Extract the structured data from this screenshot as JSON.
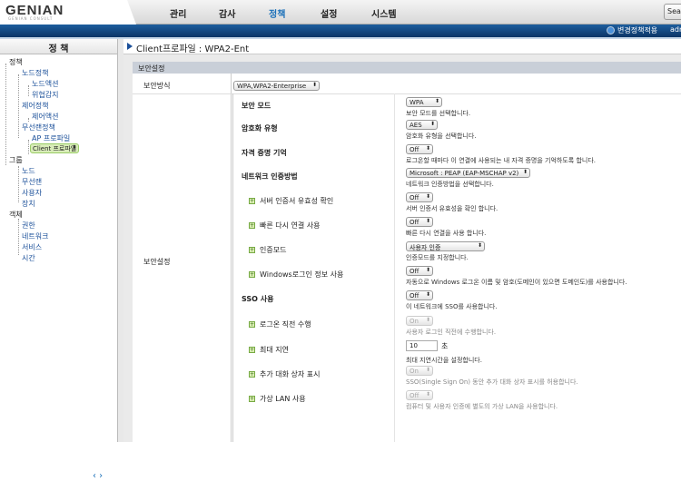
{
  "topbar": {
    "logo": "GENIAN",
    "logo_sub": "GENIAN CONSULT",
    "menus": [
      "관리",
      "감사",
      "정책",
      "설정",
      "시스템"
    ],
    "active": "정책",
    "search": "Sear"
  },
  "bluebar": {
    "apply": "변경정책적용",
    "user": "adm"
  },
  "sidebar": {
    "title": "정 책",
    "tree": [
      "정책",
      "노드정책",
      "노드액션",
      "위협감지",
      "제어정책",
      "제어액션",
      "무선랜정책",
      "AP 프로파일",
      "Client 프로파일",
      "그룹",
      "노드",
      "무선랜",
      "사용자",
      "장치",
      "객체",
      "권한",
      "네트워크",
      "서비스",
      "시간"
    ]
  },
  "crumb": "Client프로파일 : WPA2-Ent",
  "section": "보안설정",
  "form": {
    "method_label": "보안방식",
    "method_value": "WPA,WPA2-Enterprise",
    "settings_label": "보안설정",
    "rows": [
      {
        "label": "보안 모드",
        "value": "WPA",
        "desc": "보안 모드를 선택합니다."
      },
      {
        "label": "암호화 유형",
        "value": "AES",
        "desc": "암호화 유형을 선택합니다."
      },
      {
        "label": "자격 증명 기억",
        "value": "Off",
        "desc": "로그온할 때마다 이 연결에 사용되는 내 자격 증명을 기억하도록 합니다."
      },
      {
        "label": "네트워크 인증방법",
        "value": "Microsoft : PEAP (EAP-MSCHAP v2)",
        "desc": "네트워크 인증방법을 선택합니다."
      },
      {
        "label": "서버 인증서 유효성 확인",
        "value": "Off",
        "desc": "서버 인증서 유효성을 확인 합니다."
      },
      {
        "label": "빠른 다시 연결 사용",
        "value": "Off",
        "desc": "빠른 다시 연결을 사용 합니다."
      },
      {
        "label": "인증모드",
        "value": "사용자 인증",
        "desc": "인증모드를 지정합니다."
      },
      {
        "label": "Windows로그인 정보 사용",
        "value": "Off",
        "desc": "자동으로 Windows 로그온 이름 및 암호(도메인이 있으면 도메인도)를 사용합니다."
      },
      {
        "label": "SSO 사용",
        "value": "Off",
        "desc": "이 네트워크에 SSO를 사용합니다."
      },
      {
        "label": "로그온 직전 수행",
        "value": "On",
        "desc": "사용자 로그인 직전에 수행합니다."
      },
      {
        "label": "최대 지연",
        "value": "10",
        "unit": "초",
        "desc": "최대 지연시간을 설정합니다."
      },
      {
        "label": "추가 대화 상자 표시",
        "value": "On",
        "desc": "SSO(Single Sign On) 동안 추가 대화 상자 표시를 허용합니다."
      },
      {
        "label": "가상 LAN 사용",
        "value": "Off",
        "desc": "컴퓨터 및 사용자 인증에 별도의 가상 LAN을 사용합니다."
      }
    ]
  }
}
